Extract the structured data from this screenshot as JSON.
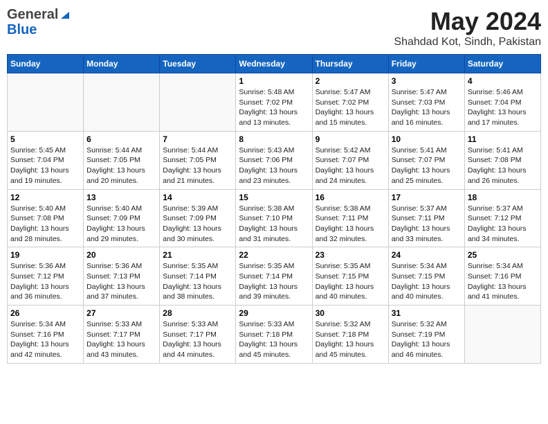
{
  "logo": {
    "general": "General",
    "blue": "Blue"
  },
  "title": "May 2024",
  "subtitle": "Shahdad Kot, Sindh, Pakistan",
  "days_of_week": [
    "Sunday",
    "Monday",
    "Tuesday",
    "Wednesday",
    "Thursday",
    "Friday",
    "Saturday"
  ],
  "weeks": [
    [
      {
        "day": "",
        "info": ""
      },
      {
        "day": "",
        "info": ""
      },
      {
        "day": "",
        "info": ""
      },
      {
        "day": "1",
        "info": "Sunrise: 5:48 AM\nSunset: 7:02 PM\nDaylight: 13 hours and 13 minutes."
      },
      {
        "day": "2",
        "info": "Sunrise: 5:47 AM\nSunset: 7:02 PM\nDaylight: 13 hours and 15 minutes."
      },
      {
        "day": "3",
        "info": "Sunrise: 5:47 AM\nSunset: 7:03 PM\nDaylight: 13 hours and 16 minutes."
      },
      {
        "day": "4",
        "info": "Sunrise: 5:46 AM\nSunset: 7:04 PM\nDaylight: 13 hours and 17 minutes."
      }
    ],
    [
      {
        "day": "5",
        "info": "Sunrise: 5:45 AM\nSunset: 7:04 PM\nDaylight: 13 hours and 19 minutes."
      },
      {
        "day": "6",
        "info": "Sunrise: 5:44 AM\nSunset: 7:05 PM\nDaylight: 13 hours and 20 minutes."
      },
      {
        "day": "7",
        "info": "Sunrise: 5:44 AM\nSunset: 7:05 PM\nDaylight: 13 hours and 21 minutes."
      },
      {
        "day": "8",
        "info": "Sunrise: 5:43 AM\nSunset: 7:06 PM\nDaylight: 13 hours and 23 minutes."
      },
      {
        "day": "9",
        "info": "Sunrise: 5:42 AM\nSunset: 7:07 PM\nDaylight: 13 hours and 24 minutes."
      },
      {
        "day": "10",
        "info": "Sunrise: 5:41 AM\nSunset: 7:07 PM\nDaylight: 13 hours and 25 minutes."
      },
      {
        "day": "11",
        "info": "Sunrise: 5:41 AM\nSunset: 7:08 PM\nDaylight: 13 hours and 26 minutes."
      }
    ],
    [
      {
        "day": "12",
        "info": "Sunrise: 5:40 AM\nSunset: 7:08 PM\nDaylight: 13 hours and 28 minutes."
      },
      {
        "day": "13",
        "info": "Sunrise: 5:40 AM\nSunset: 7:09 PM\nDaylight: 13 hours and 29 minutes."
      },
      {
        "day": "14",
        "info": "Sunrise: 5:39 AM\nSunset: 7:09 PM\nDaylight: 13 hours and 30 minutes."
      },
      {
        "day": "15",
        "info": "Sunrise: 5:38 AM\nSunset: 7:10 PM\nDaylight: 13 hours and 31 minutes."
      },
      {
        "day": "16",
        "info": "Sunrise: 5:38 AM\nSunset: 7:11 PM\nDaylight: 13 hours and 32 minutes."
      },
      {
        "day": "17",
        "info": "Sunrise: 5:37 AM\nSunset: 7:11 PM\nDaylight: 13 hours and 33 minutes."
      },
      {
        "day": "18",
        "info": "Sunrise: 5:37 AM\nSunset: 7:12 PM\nDaylight: 13 hours and 34 minutes."
      }
    ],
    [
      {
        "day": "19",
        "info": "Sunrise: 5:36 AM\nSunset: 7:12 PM\nDaylight: 13 hours and 36 minutes."
      },
      {
        "day": "20",
        "info": "Sunrise: 5:36 AM\nSunset: 7:13 PM\nDaylight: 13 hours and 37 minutes."
      },
      {
        "day": "21",
        "info": "Sunrise: 5:35 AM\nSunset: 7:14 PM\nDaylight: 13 hours and 38 minutes."
      },
      {
        "day": "22",
        "info": "Sunrise: 5:35 AM\nSunset: 7:14 PM\nDaylight: 13 hours and 39 minutes."
      },
      {
        "day": "23",
        "info": "Sunrise: 5:35 AM\nSunset: 7:15 PM\nDaylight: 13 hours and 40 minutes."
      },
      {
        "day": "24",
        "info": "Sunrise: 5:34 AM\nSunset: 7:15 PM\nDaylight: 13 hours and 40 minutes."
      },
      {
        "day": "25",
        "info": "Sunrise: 5:34 AM\nSunset: 7:16 PM\nDaylight: 13 hours and 41 minutes."
      }
    ],
    [
      {
        "day": "26",
        "info": "Sunrise: 5:34 AM\nSunset: 7:16 PM\nDaylight: 13 hours and 42 minutes."
      },
      {
        "day": "27",
        "info": "Sunrise: 5:33 AM\nSunset: 7:17 PM\nDaylight: 13 hours and 43 minutes."
      },
      {
        "day": "28",
        "info": "Sunrise: 5:33 AM\nSunset: 7:17 PM\nDaylight: 13 hours and 44 minutes."
      },
      {
        "day": "29",
        "info": "Sunrise: 5:33 AM\nSunset: 7:18 PM\nDaylight: 13 hours and 45 minutes."
      },
      {
        "day": "30",
        "info": "Sunrise: 5:32 AM\nSunset: 7:18 PM\nDaylight: 13 hours and 45 minutes."
      },
      {
        "day": "31",
        "info": "Sunrise: 5:32 AM\nSunset: 7:19 PM\nDaylight: 13 hours and 46 minutes."
      },
      {
        "day": "",
        "info": ""
      }
    ]
  ]
}
